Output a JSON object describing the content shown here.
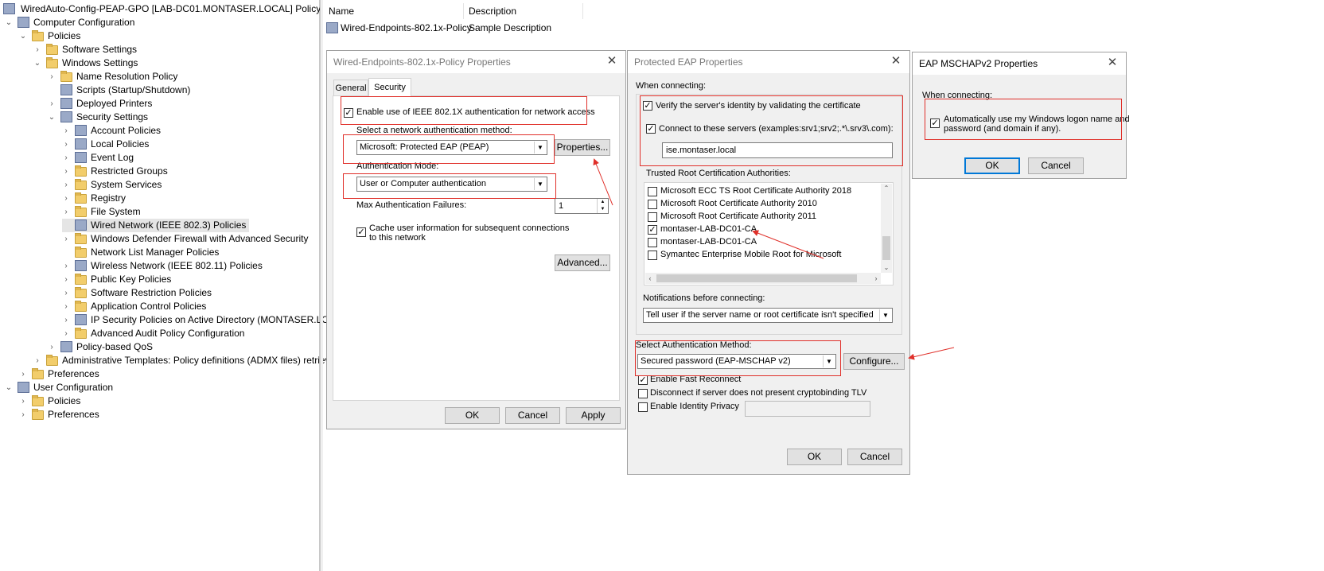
{
  "tree": {
    "root": "WiredAuto-Config-PEAP-GPO [LAB-DC01.MONTASER.LOCAL] Policy",
    "items": [
      {
        "label": "Computer Configuration"
      },
      {
        "label": "Policies"
      },
      {
        "label": "Software Settings"
      },
      {
        "label": "Windows Settings"
      },
      {
        "label": "Name Resolution Policy"
      },
      {
        "label": "Scripts (Startup/Shutdown)"
      },
      {
        "label": "Deployed Printers"
      },
      {
        "label": "Security Settings"
      },
      {
        "label": "Account Policies"
      },
      {
        "label": "Local Policies"
      },
      {
        "label": "Event Log"
      },
      {
        "label": "Restricted Groups"
      },
      {
        "label": "System Services"
      },
      {
        "label": "Registry"
      },
      {
        "label": "File System"
      },
      {
        "label": "Wired Network (IEEE 802.3) Policies"
      },
      {
        "label": "Windows Defender Firewall with Advanced Security"
      },
      {
        "label": "Network List Manager Policies"
      },
      {
        "label": "Wireless Network (IEEE 802.11) Policies"
      },
      {
        "label": "Public Key Policies"
      },
      {
        "label": "Software Restriction Policies"
      },
      {
        "label": "Application Control Policies"
      },
      {
        "label": "IP Security Policies on Active Directory (MONTASER.LOCA"
      },
      {
        "label": "Advanced Audit Policy Configuration"
      },
      {
        "label": "Policy-based QoS"
      },
      {
        "label": "Administrative Templates: Policy definitions (ADMX files) retrieve"
      },
      {
        "label": "Preferences"
      },
      {
        "label": "User Configuration"
      },
      {
        "label": "Policies"
      },
      {
        "label": "Preferences"
      }
    ]
  },
  "list": {
    "col_name": "Name",
    "col_desc": "Description",
    "row_name": "Wired-Endpoints-802.1x-Policy",
    "row_desc": "Sample Description"
  },
  "dlg1": {
    "title": "Wired-Endpoints-802.1x-Policy Properties",
    "tab_general": "General",
    "tab_security": "Security",
    "enable_label": "Enable use of IEEE 802.1X authentication for network access",
    "method_label": "Select a network authentication method:",
    "method_value": "Microsoft: Protected EAP (PEAP)",
    "properties_btn": "Properties...",
    "mode_label": "Authentication Mode:",
    "mode_value": "User or Computer authentication",
    "max_fail_label": "Max Authentication Failures:",
    "max_fail_value": "1",
    "cache_label_1": "Cache user information for subsequent connections",
    "cache_label_2": "to this network",
    "advanced_btn": "Advanced...",
    "ok": "OK",
    "cancel": "Cancel",
    "apply": "Apply"
  },
  "dlg2": {
    "title": "Protected EAP Properties",
    "when_connecting": "When connecting:",
    "verify_label": "Verify the server's identity by validating the certificate",
    "connect_label": "Connect to these servers (examples:srv1;srv2;.*\\.srv3\\.com):",
    "server_value": "ise.montaser.local",
    "trusted_label": "Trusted Root Certification Authorities:",
    "cas": [
      {
        "name": "Microsoft ECC TS Root Certificate Authority 2018",
        "checked": false
      },
      {
        "name": "Microsoft Root Certificate Authority 2010",
        "checked": false
      },
      {
        "name": "Microsoft Root Certificate Authority 2011",
        "checked": false
      },
      {
        "name": "montaser-LAB-DC01-CA",
        "checked": true
      },
      {
        "name": "montaser-LAB-DC01-CA",
        "checked": false
      },
      {
        "name": "Symantec Enterprise Mobile Root for Microsoft",
        "checked": false
      }
    ],
    "notif_label": "Notifications before connecting:",
    "notif_value": "Tell user if the server name or root certificate isn't specified",
    "select_method_label": "Select Authentication Method:",
    "select_method_value": "Secured password (EAP-MSCHAP v2)",
    "configure_btn": "Configure...",
    "fast_reconnect": "Enable Fast Reconnect",
    "disconnect_label": "Disconnect if server does not present cryptobinding TLV",
    "identity_privacy": "Enable Identity Privacy",
    "ok": "OK",
    "cancel": "Cancel"
  },
  "dlg3": {
    "title": "EAP MSCHAPv2 Properties",
    "when_connecting": "When connecting:",
    "auto_label_1": "Automatically use my Windows logon name and",
    "auto_label_2": "password (and domain if any).",
    "ok": "OK",
    "cancel": "Cancel"
  },
  "colors": {
    "annotation_red": "#e0302a",
    "selection_bg": "#e5e5e5",
    "dialog_bg": "#f0f0f0"
  }
}
